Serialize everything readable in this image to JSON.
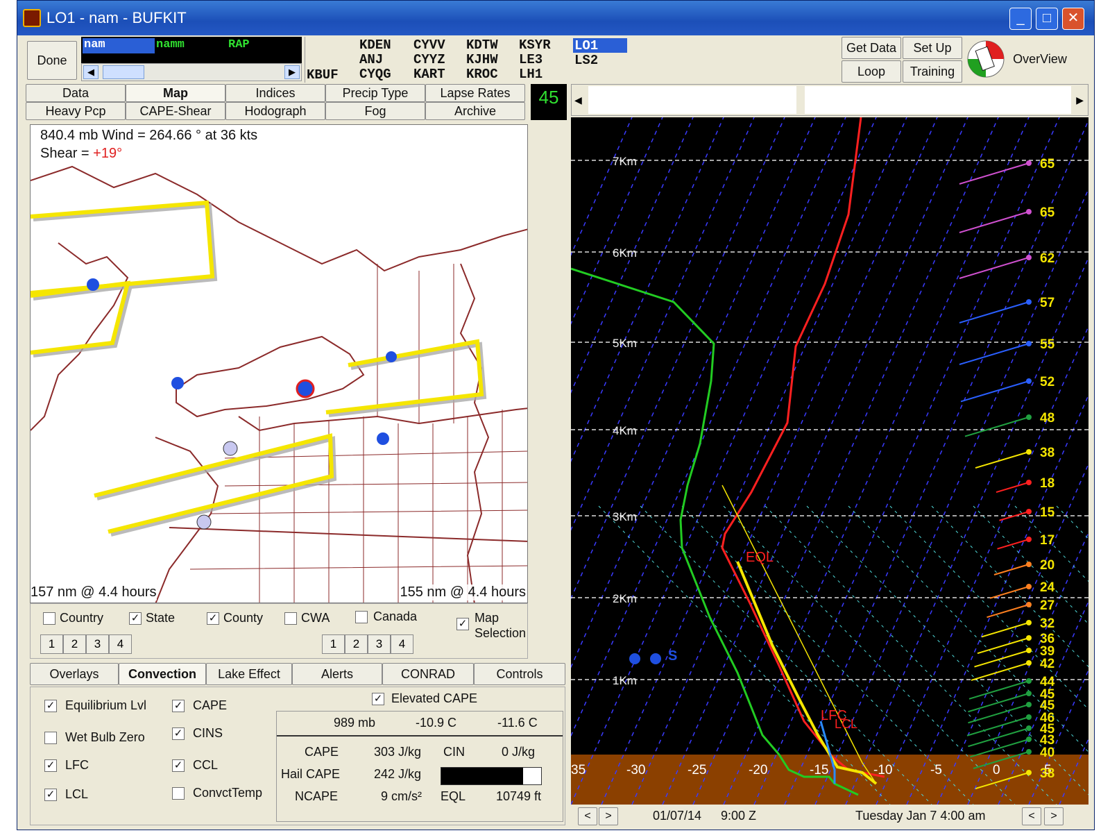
{
  "window": {
    "title": "LO1 - nam - BUFKIT"
  },
  "top": {
    "done": "Done",
    "models": [
      "nam",
      "namm",
      "RAP"
    ],
    "stations_col1": [
      "KDEN",
      "ANJ",
      "CYQG"
    ],
    "stations_col2": [
      "CYVV",
      "CYYZ",
      "KART"
    ],
    "stations_col3": [
      "KDTW",
      "KJHW",
      "KROC"
    ],
    "stations_col4": [
      "KSYR",
      "LE3",
      "LH1"
    ],
    "kbuf": "KBUF",
    "lo1": "LO1",
    "ls2": "LS2",
    "get_data": "Get Data",
    "set_up": "Set Up",
    "loop": "Loop",
    "training": "Training",
    "overview": "OverView",
    "frame_num": "45"
  },
  "tabs_row1": [
    "Data",
    "Map",
    "Indices",
    "Precip Type",
    "Lapse Rates"
  ],
  "tabs_row2": [
    "Heavy Pcp",
    "CAPE-Shear",
    "Hodograph",
    "Fog",
    "Archive"
  ],
  "map": {
    "wind_line": "840.4 mb Wind =  264.66 ° at 36  kts",
    "shear_label": "Shear = ",
    "shear_value": "+19°",
    "left_status": "157 nm  @ 4.4 hours",
    "right_status": "155 nm  @ 4.4 hours"
  },
  "map_checks": [
    {
      "label": "Country",
      "checked": false
    },
    {
      "label": "State",
      "checked": true
    },
    {
      "label": "County",
      "checked": true
    },
    {
      "label": "CWA",
      "checked": false
    },
    {
      "label": "Canada",
      "checked": false
    }
  ],
  "map_selection": {
    "label1": "Map",
    "label2": "Selection",
    "checked": true
  },
  "num_buttons": [
    "1",
    "2",
    "3",
    "4"
  ],
  "tabs_row3": [
    "Overlays",
    "Convection",
    "Lake Effect",
    "Alerts",
    "CONRAD",
    "Controls"
  ],
  "convection_checks": [
    {
      "label": "Equilibrium Lvl",
      "checked": true
    },
    {
      "label": "Wet Bulb Zero",
      "checked": false
    },
    {
      "label": "LFC",
      "checked": true
    },
    {
      "label": "LCL",
      "checked": true
    },
    {
      "label": "CAPE",
      "checked": true
    },
    {
      "label": "CINS",
      "checked": true
    },
    {
      "label": "CCL",
      "checked": true
    },
    {
      "label": "ConvctTemp",
      "checked": false
    },
    {
      "label": "Elevated CAPE",
      "checked": true
    }
  ],
  "cape_table": {
    "header": [
      "989 mb",
      "-10.9 C",
      "-11.6 C"
    ],
    "cape_label": "CAPE",
    "cape_value": "303 J/kg",
    "cin_label": "CIN",
    "cin_value": "0 J/kg",
    "hail_label": "Hail CAPE",
    "hail_value": "242 J/kg",
    "ncape_label": "NCAPE",
    "ncape_value": "9 cm/s²",
    "eql_label": "EQL",
    "eql_value": "10749 ft",
    "bar_fraction": 0.82
  },
  "sounding": {
    "heights": [
      "7Km",
      "6Km",
      "5Km",
      "4Km",
      "3Km",
      "2Km",
      "1Km"
    ],
    "temp_axis": [
      "35",
      "-30",
      "-25",
      "-20",
      "-15",
      "-10",
      "-5",
      "0",
      "5"
    ],
    "wind_speeds": [
      "65",
      "65",
      "62",
      "57",
      "55",
      "52",
      "48",
      "38",
      "18",
      "15",
      "17",
      "20",
      "24",
      "27",
      "32",
      "36",
      "39",
      "42",
      "44",
      "45",
      "45",
      "46",
      "45",
      "43",
      "40",
      "38"
    ],
    "eql_marker": "EQL",
    "lfc_marker": "LFC",
    "lcl_marker": "LCL",
    "storm_marker": "S"
  },
  "bottom": {
    "date": "01/07/14",
    "time": "9:00 Z",
    "local": "Tuesday   Jan 7 4:00 am"
  },
  "colors": {
    "temp": "#ff2020",
    "dew": "#22cc22",
    "parcel": "#f5e600",
    "ground": "#8b4000"
  }
}
